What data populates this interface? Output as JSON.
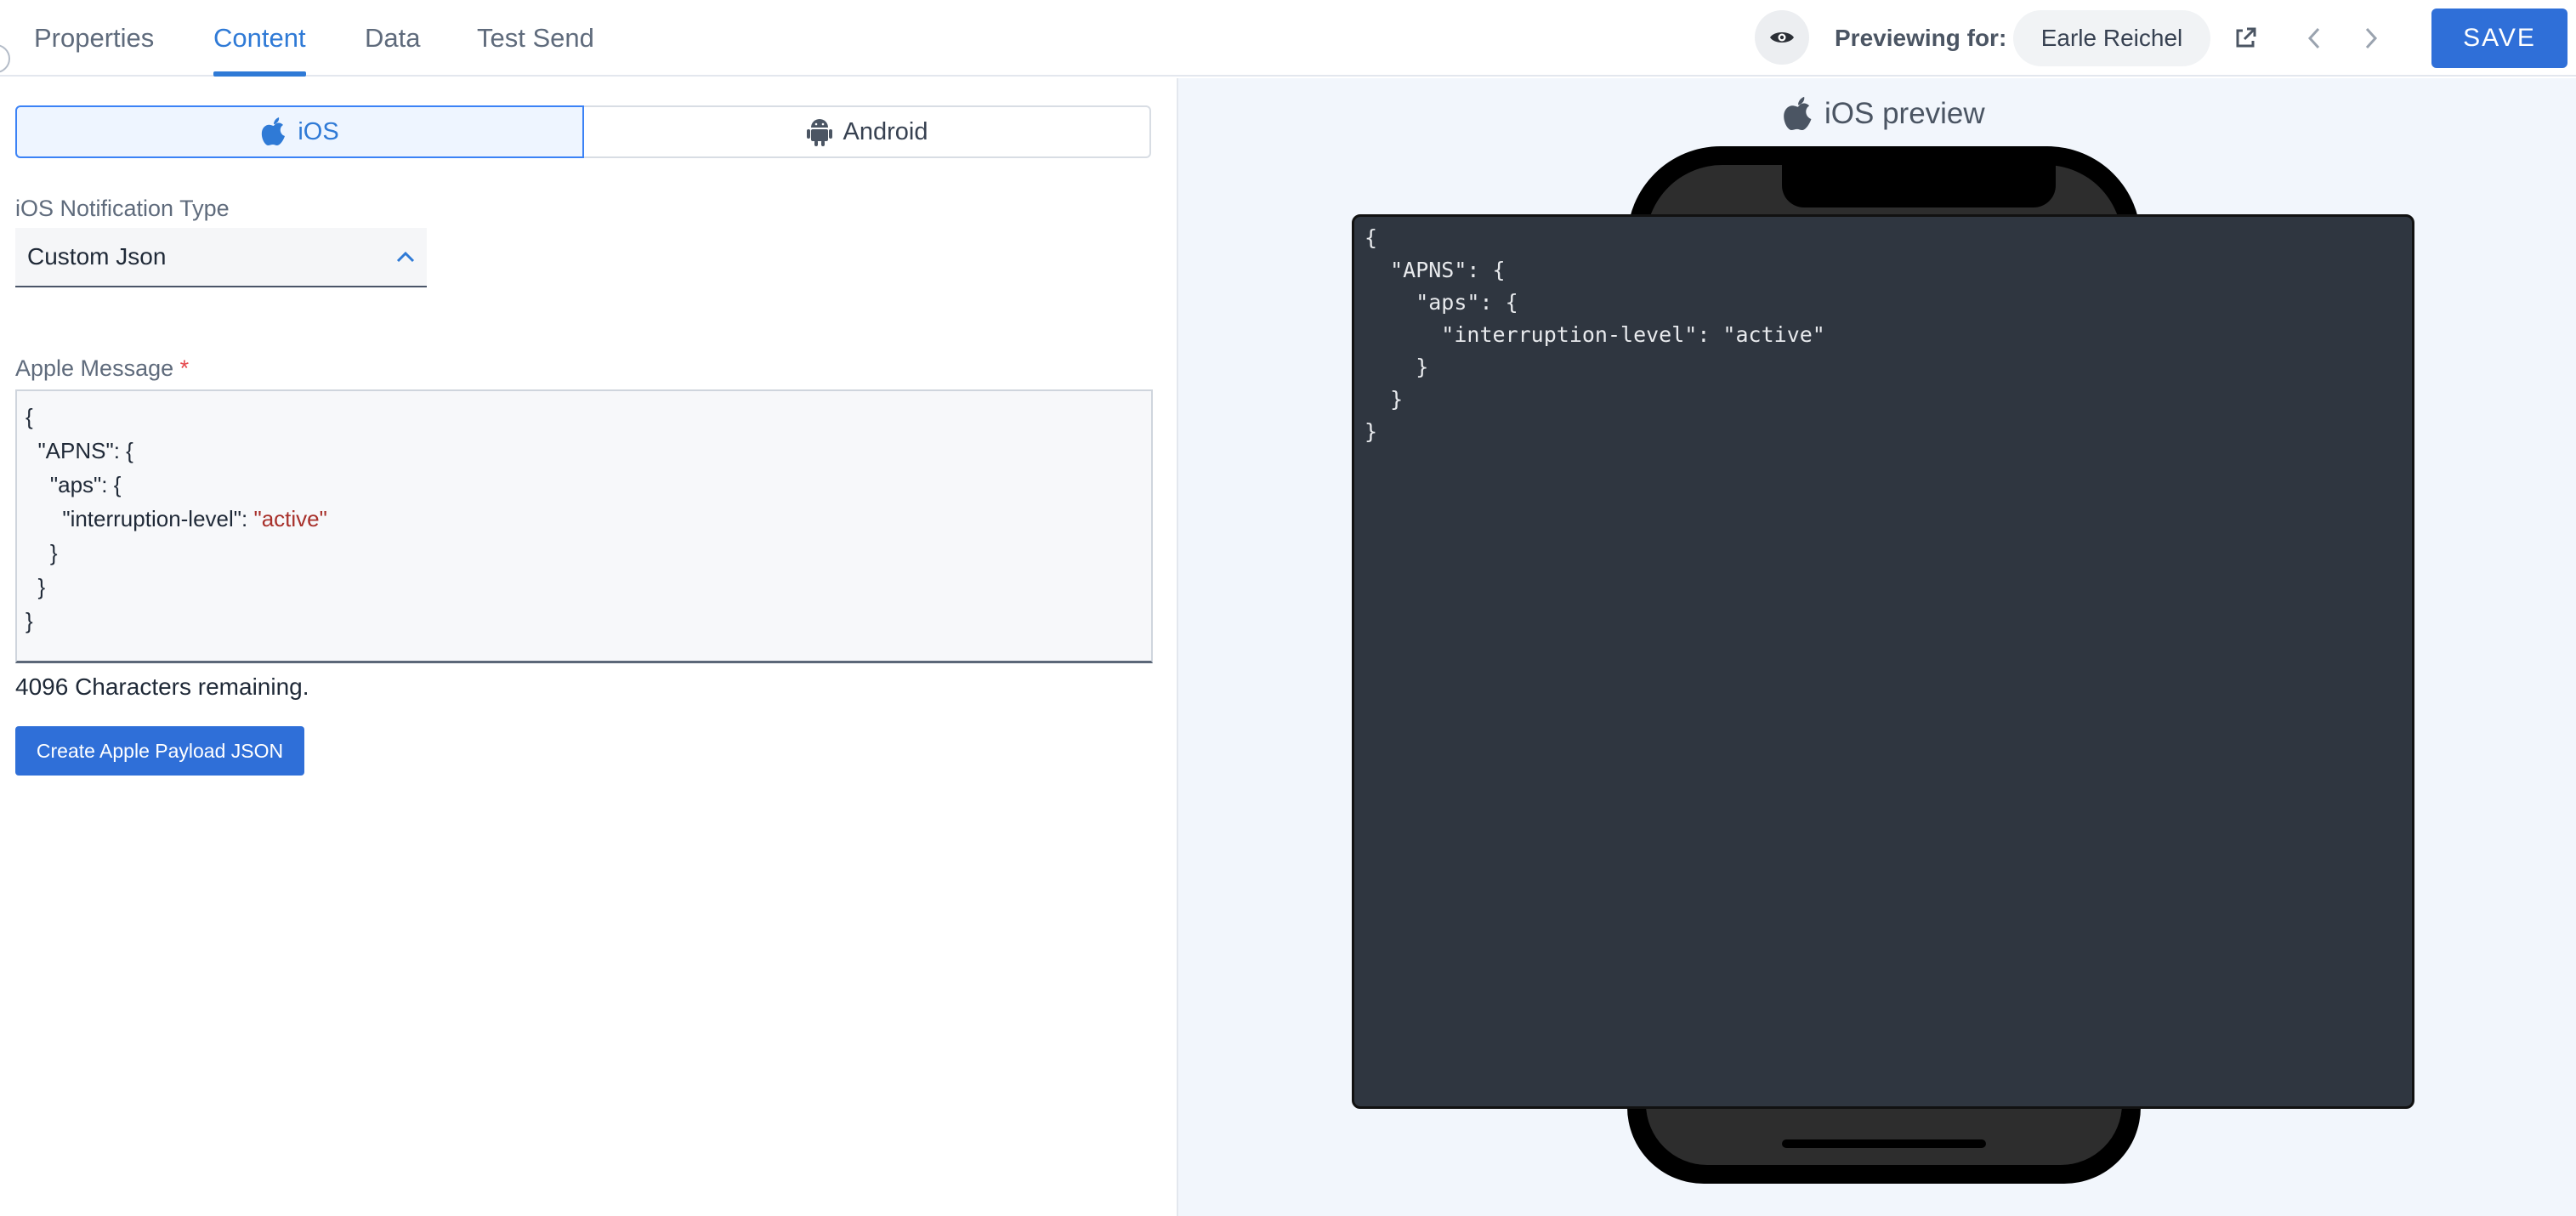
{
  "tabs": [
    {
      "label": "Properties",
      "active": false
    },
    {
      "label": "Content",
      "active": true
    },
    {
      "label": "Data",
      "active": false
    },
    {
      "label": "Test Send",
      "active": false
    }
  ],
  "header": {
    "previewing_label": "Previewing for:",
    "previewing_user": "Earle Reichel",
    "save_label": "SAVE",
    "icons": [
      "eye-icon",
      "external-link-icon",
      "chevron-left-icon",
      "chevron-right-icon"
    ]
  },
  "platform": {
    "selected": "iOS",
    "options": [
      {
        "label": "iOS",
        "icon": "apple-icon"
      },
      {
        "label": "Android",
        "icon": "android-icon"
      }
    ]
  },
  "notification_type": {
    "label": "iOS Notification Type",
    "value": "Custom Json"
  },
  "apple_message": {
    "label": "Apple Message",
    "required_marker": "*",
    "lines": [
      {
        "text": "{"
      },
      {
        "text": "  \"APNS\": {"
      },
      {
        "text": "    \"aps\": {"
      },
      {
        "text": "      \"interruption-level\": ",
        "value": "\"active\""
      },
      {
        "text": "    }"
      },
      {
        "text": "  }"
      },
      {
        "text": "}"
      }
    ],
    "chars_remaining": "4096 Characters remaining."
  },
  "create_button_label": "Create Apple Payload JSON",
  "preview": {
    "title": "iOS preview",
    "json_lines": [
      "{",
      "  \"APNS\": {",
      "    \"aps\": {",
      "      \"interruption-level\": \"active\"",
      "    }",
      "  }",
      "}"
    ]
  },
  "colors": {
    "accent": "#2f7ad6",
    "button": "#2f6fd8",
    "preview_background": "#f2f6fc",
    "preview_screen": "#2f3640",
    "string_value": "#a8312b"
  }
}
